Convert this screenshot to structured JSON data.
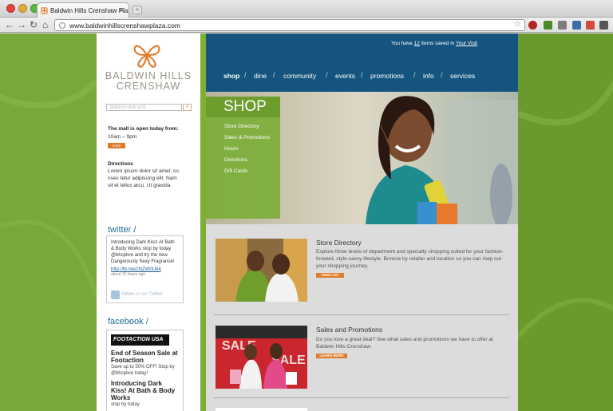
{
  "browser": {
    "tab_title": "Baldwin Hills Crenshaw Plaza",
    "tab_close": "✕",
    "new_tab": "+",
    "url": "www.baldwinhillscrenshawplaza.com",
    "star": "☆",
    "nav": {
      "back": "←",
      "forward": "→",
      "reload": "↻",
      "home": "⌂"
    }
  },
  "sidebar": {
    "logo_line1": "BALDWIN HILLS",
    "logo_line2": "CRENSHAW",
    "search_placeholder": "SEARCH OUR SITE",
    "search_go": "»",
    "hours_heading": "The mall is open today from:",
    "hours": "10am – 9pm",
    "more": "more",
    "directions_heading": "Directions",
    "directions_text": "Lorem ipsum dolor sit amet, co nsec tetur adipiscing elit. Nam sit et tellus arcu. Ut gravida.",
    "twitter_heading": "twitter /",
    "tweet_text": "Introducing Dark Kiss! At Bath & Body Works stop by today @bhcplive and try the new Dangerously Sexy Fragrance!",
    "tweet_link": "http://fb.me/zNZW0Ub4",
    "tweet_time": "about 15 hours ago",
    "follow": "follow us on Twitter",
    "facebook_heading": "facebook /",
    "fb_logo": "FOOTACTION USA",
    "fb_post1_title": "End of Season Sale at Footaction",
    "fb_post1_text": "Save up to 50% OFF! Stop by @bhcplive today!",
    "fb_post2_title": "Introducing Dark Kiss! At Bath & Body Works",
    "fb_post2_text": "stop by today"
  },
  "header": {
    "saved_prefix": "You have ",
    "saved_count": "12",
    "saved_middle": " items saved in ",
    "saved_link": "Your Visit",
    "nav": [
      "shop",
      "dine",
      "community",
      "events",
      "promotions",
      "info",
      "services"
    ],
    "sep": "/"
  },
  "hero": {
    "title": "SHOP",
    "links": [
      "Store Directory",
      "Sales & Promotions",
      "Hours",
      "Directions",
      "Gift Cards"
    ]
  },
  "items": [
    {
      "title": "Store Directory",
      "text": "Explore three levels of department and specialty shopping suited for your fashion-forward, style-savvy lifestyle. Browse by retailer and location so you can map out your shopping journey.",
      "button": "VIEW LIST"
    },
    {
      "title": "Sales and Promotions",
      "text": "Do you love a great deal? See what sales and promotions we have to offer at Baldwin Hills Crenshaw.",
      "button": "LEARN MORE"
    }
  ],
  "colors": {
    "green": "#6a9a2e",
    "blue": "#14547e",
    "orange": "#e07b2a"
  }
}
